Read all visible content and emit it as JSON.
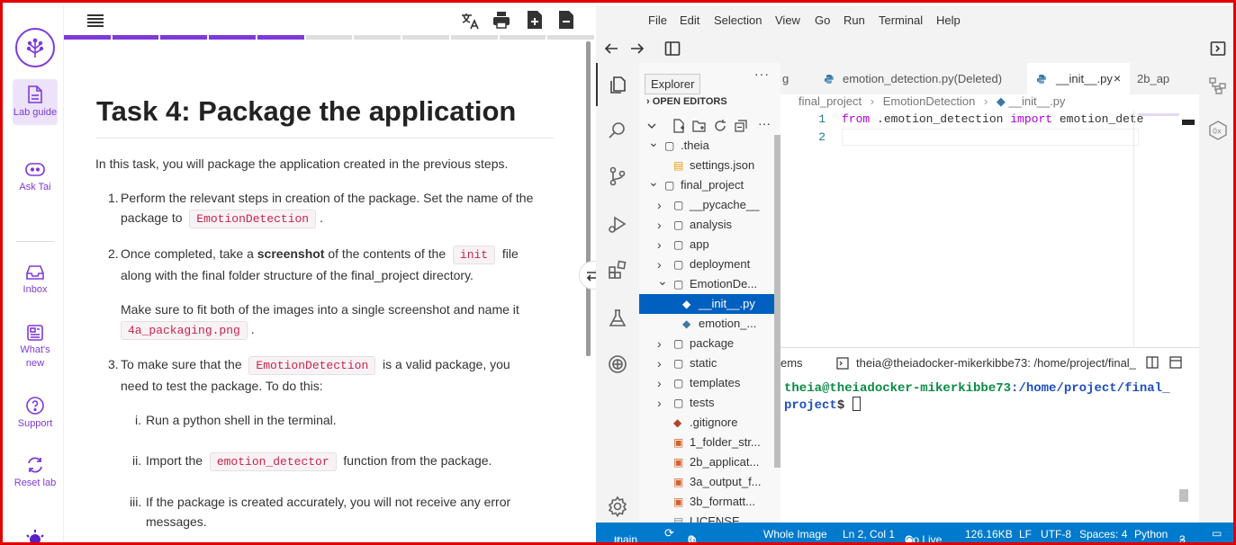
{
  "rail": {
    "items": [
      {
        "label": "Lab guide"
      },
      {
        "label": "Ask Tai"
      },
      {
        "label": "Inbox"
      },
      {
        "label": "What's new"
      },
      {
        "label": "Support"
      },
      {
        "label": "Reset lab"
      }
    ]
  },
  "guide": {
    "title": "Task 4: Package the application",
    "intro": "In this task, you will package the application created in the previous steps.",
    "step1": {
      "num": "1.",
      "text_a": "Perform the relevant steps in creation of the package. Set the name of the",
      "text_b": "package to",
      "code": "EmotionDetection",
      "text_c": "."
    },
    "step2": {
      "num": "2.",
      "text_a": "Once completed, take a",
      "bold": "screenshot",
      "text_b": "of the contents of the",
      "code": "init",
      "text_c": "file",
      "text_d": "along with the final folder structure of the final_project directory.",
      "text_e": "Make sure to fit both of the images into a single screenshot and name it",
      "code2": "4a_packaging.png",
      "text_f": "."
    },
    "step3": {
      "num": "3.",
      "text_a": "To make sure that the",
      "code": "EmotionDetection",
      "text_b": "is a valid package, you",
      "text_c": "need to test the package. To do this:"
    },
    "sub1": {
      "num": "i.",
      "text": "Run a python shell in the terminal."
    },
    "sub2": {
      "num": "ii.",
      "text_a": "Import the",
      "code": "emotion_detector",
      "text_b": "function from the package."
    },
    "sub3": {
      "num": "iii.",
      "text_a": "If the package is created accurately, you will not receive any error",
      "text_b": "messages."
    }
  },
  "ide": {
    "menu": [
      "File",
      "Edit",
      "Selection",
      "View",
      "Go",
      "Run",
      "Terminal",
      "Help"
    ],
    "tooltip": "Explorer",
    "open_editors": "OPEN EDITORS",
    "sidebar_header_tail": "t",
    "tree": [
      {
        "label": ".theia",
        "kind": "folder-open",
        "indent": 1
      },
      {
        "label": "settings.json",
        "kind": "json",
        "indent": 2
      },
      {
        "label": "final_project",
        "kind": "folder-open",
        "indent": 1
      },
      {
        "label": "__pycache__",
        "kind": "folder",
        "indent": 2
      },
      {
        "label": "analysis",
        "kind": "folder",
        "indent": 2
      },
      {
        "label": "app",
        "kind": "folder",
        "indent": 2
      },
      {
        "label": "deployment",
        "kind": "folder",
        "indent": 2
      },
      {
        "label": "EmotionDe...",
        "kind": "folder-open",
        "indent": 2
      },
      {
        "label": "__init__.py",
        "kind": "py",
        "indent": 3,
        "selected": true
      },
      {
        "label": "emotion_...",
        "kind": "py",
        "indent": 3
      },
      {
        "label": "package",
        "kind": "folder",
        "indent": 2
      },
      {
        "label": "static",
        "kind": "folder",
        "indent": 2
      },
      {
        "label": "templates",
        "kind": "folder",
        "indent": 2
      },
      {
        "label": "tests",
        "kind": "folder",
        "indent": 2
      },
      {
        "label": ".gitignore",
        "kind": "git",
        "indent": 2
      },
      {
        "label": "1_folder_str...",
        "kind": "img",
        "indent": 2
      },
      {
        "label": "2b_applicat...",
        "kind": "img",
        "indent": 2
      },
      {
        "label": "3a_output_f...",
        "kind": "img",
        "indent": 2
      },
      {
        "label": "3b_formatt...",
        "kind": "img",
        "indent": 2
      },
      {
        "label": "LICENSE",
        "kind": "file",
        "indent": 2
      }
    ],
    "tabs": {
      "t0": "g",
      "t1": "emotion_detection.py(Deleted)",
      "t2": "__init__.py",
      "t3": "2b_ap"
    },
    "breadcrumb": {
      "a": "final_project",
      "b": "EmotionDetection",
      "c": "__init__.py"
    },
    "code": {
      "l1": "1",
      "l2": "2",
      "from": "from",
      "mod": " .emotion_detection ",
      "imp": "import",
      "name": " emotion_dete"
    },
    "terminal": {
      "tab_left": "ems",
      "title": "theia@theiadocker-mikerkibbe73: /home/project/final_",
      "prompt_user": "theia@theiadocker-mikerkibbe73",
      "prompt_path": ":/home/project/final_",
      "prompt_path2": "project",
      "prompt_end": "$ "
    },
    "status": {
      "branch": "main",
      "errors": "0",
      "warnings": "0",
      "whole": "Whole Image",
      "pos": "Ln 2, Col 1",
      "golive": "Go Live",
      "size": "126.16KB",
      "eol": "LF",
      "enc": "UTF-8",
      "spaces": "Spaces: 4",
      "lang": "Python",
      "ports": "3"
    },
    "colors": {
      "accent": "#7e3ad9",
      "status": "#007acc",
      "selection": "#0060c0",
      "frame": "#e00000"
    }
  }
}
